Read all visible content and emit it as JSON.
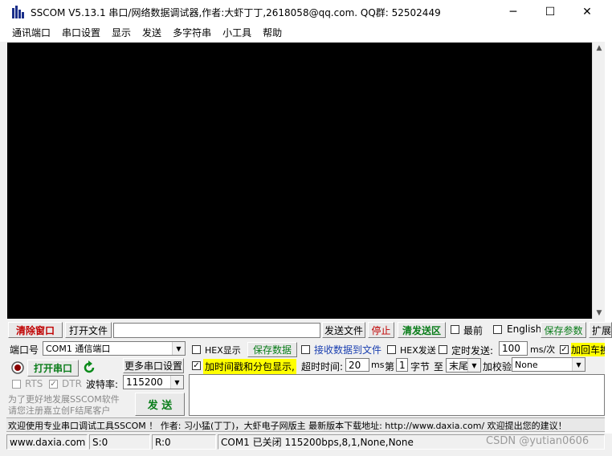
{
  "window": {
    "title": "SSCOM V5.13.1 串口/网络数据调试器,作者:大虾丁丁,2618058@qq.com. QQ群: 52502449",
    "minimize": "─",
    "maximize": "☐",
    "close": "✕"
  },
  "menu": [
    "通讯端口",
    "串口设置",
    "显示",
    "发送",
    "多字符串",
    "小工具",
    "帮助"
  ],
  "row1": {
    "clear_window": "清除窗口",
    "open_file": "打开文件",
    "file_path": "",
    "send_file": "发送文件",
    "stop": "停止",
    "clear_send": "清发送区",
    "topmost": "最前",
    "english": "English",
    "save_params": "保存参数",
    "expand": "扩展"
  },
  "port": {
    "label": "端口号",
    "value": "COM1 通信端口",
    "open_button": "打开串口",
    "more_settings": "更多串口设置",
    "rts": "RTS",
    "dtr": "DTR",
    "baud_label": "波特率:",
    "baud_value": "115200"
  },
  "options": {
    "hex_display": "HEX显示",
    "save_data": "保存数据",
    "recv_to_file": "接收数据到文件",
    "hex_send": "HEX发送",
    "timed_send": "定时发送:",
    "interval_value": "100",
    "interval_unit": "ms/次",
    "add_crlf": "加回车换行",
    "add_timestamp": "加时间戳和分包显示,",
    "timeout_label": "超时时间:",
    "timeout_value": "20",
    "timeout_unit": "ms",
    "nth_label": "第",
    "nth_value": "1",
    "byte_label": "字节",
    "to_label": "至",
    "end_value": "末尾",
    "checksum_label": "加校验",
    "checksum_value": "None"
  },
  "promo": {
    "line1": "为了更好地发展SSCOM软件",
    "line2": "请您注册嘉立创F结尾客户"
  },
  "send_button": "发  送",
  "marquee": "欢迎使用专业串口调试工具SSCOM ！  作者: 习小猛(丁丁)，大虾电子网版主  最新版本下载地址: http://www.daxia.com/  欢迎提出您的建议！",
  "status": {
    "website": "www.daxia.com",
    "sent": "S:0",
    "received": "R:0",
    "port_state": "COM1 已关闭  115200bps,8,1,None,None",
    "watermark": "CSDN @yutian0606"
  }
}
